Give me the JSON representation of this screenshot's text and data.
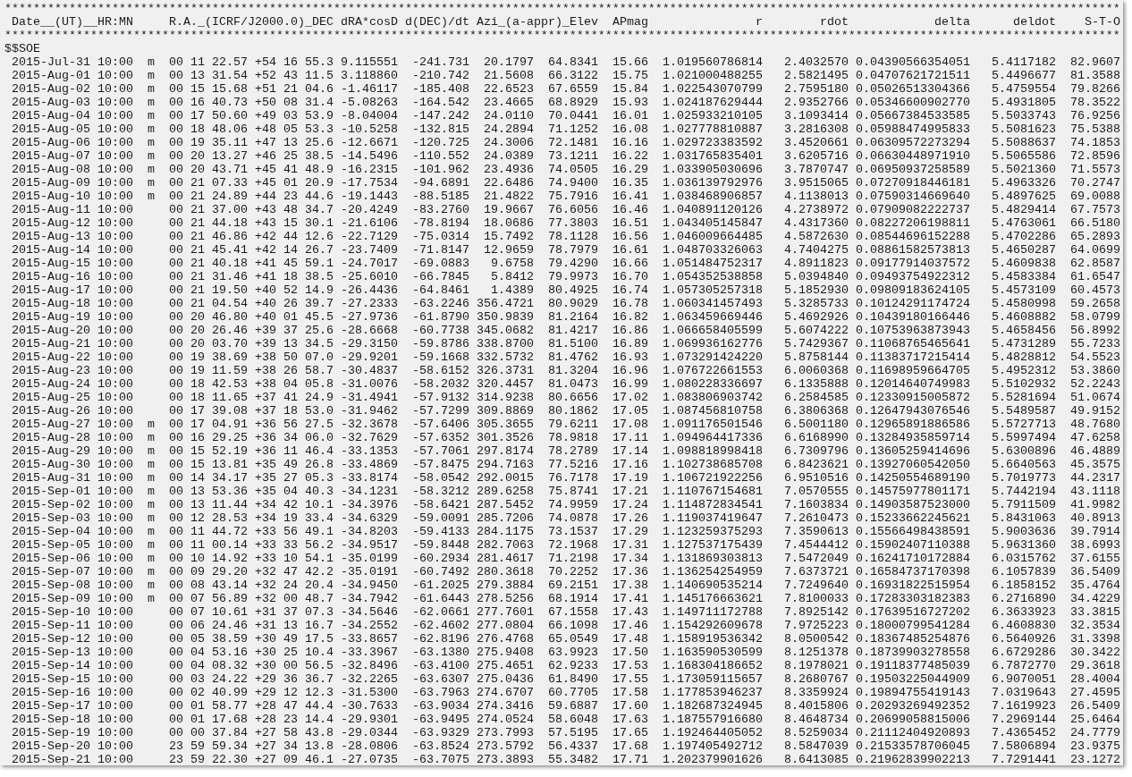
{
  "separator_top": "************************************************************************************************************************************************************",
  "header": [
    "Date__(UT)__HR:MN",
    "R.A._(ICRF/J2000.0)_DEC",
    "dRA*cosD",
    "d(DEC)/dt",
    "Azi_(a-appr)_Elev",
    "APmag",
    "r",
    "rdot",
    "delta",
    "deldot",
    "S-T-O"
  ],
  "separator_bottom": "************************************************************************************************************************************************************",
  "start_marker": "$$SOE",
  "rows": [
    {
      "date_time": "2015-Jul-31 10:00",
      "marker": "m",
      "ra": "00 11 22.57",
      "dec": "+54 16 55.3",
      "dra_cosd": "9.115551",
      "ddec_dt": "-241.731",
      "azi": "20.1797",
      "elev": "64.8341",
      "apmag": "15.66",
      "r": "1.019560786814",
      "rdot": "2.4032570",
      "delta": "0.04390566354051",
      "deldot": "5.4117182",
      "sto": "82.9607"
    },
    {
      "date_time": "2015-Aug-01 10:00",
      "marker": "m",
      "ra": "00 13 31.54",
      "dec": "+52 43 11.5",
      "dra_cosd": "3.118860",
      "ddec_dt": "-210.742",
      "azi": "21.5608",
      "elev": "66.3122",
      "apmag": "15.75",
      "r": "1.021000488255",
      "rdot": "2.5821495",
      "delta": "0.04707621721511",
      "deldot": "5.4496677",
      "sto": "81.3588"
    },
    {
      "date_time": "2015-Aug-02 10:00",
      "marker": "m",
      "ra": "00 15 15.68",
      "dec": "+51 21 04.6",
      "dra_cosd": "-1.46117",
      "ddec_dt": "-185.408",
      "azi": "22.6523",
      "elev": "67.6559",
      "apmag": "15.84",
      "r": "1.022543070799",
      "rdot": "2.7595180",
      "delta": "0.05026513304366",
      "deldot": "5.4759554",
      "sto": "79.8266"
    },
    {
      "date_time": "2015-Aug-03 10:00",
      "marker": "m",
      "ra": "00 16 40.73",
      "dec": "+50 08 31.4",
      "dra_cosd": "-5.08263",
      "ddec_dt": "-164.542",
      "azi": "23.4665",
      "elev": "68.8929",
      "apmag": "15.93",
      "r": "1.024187629444",
      "rdot": "2.9352766",
      "delta": "0.05346600902770",
      "deldot": "5.4931805",
      "sto": "78.3522"
    },
    {
      "date_time": "2015-Aug-04 10:00",
      "marker": "m",
      "ra": "00 17 50.60",
      "dec": "+49 03 53.9",
      "dra_cosd": "-8.04004",
      "ddec_dt": "-147.242",
      "azi": "24.0110",
      "elev": "70.0441",
      "apmag": "16.01",
      "r": "1.025933210105",
      "rdot": "3.1093414",
      "delta": "0.05667384533585",
      "deldot": "5.5033743",
      "sto": "76.9256"
    },
    {
      "date_time": "2015-Aug-05 10:00",
      "marker": "m",
      "ra": "00 18 48.06",
      "dec": "+48 05 53.3",
      "dra_cosd": "-10.5258",
      "ddec_dt": "-132.815",
      "azi": "24.2894",
      "elev": "71.1252",
      "apmag": "16.08",
      "r": "1.027778810887",
      "rdot": "3.2816308",
      "delta": "0.05988474995833",
      "deldot": "5.5081623",
      "sto": "75.5388"
    },
    {
      "date_time": "2015-Aug-06 10:00",
      "marker": "m",
      "ra": "00 19 35.11",
      "dec": "+47 13 25.6",
      "dra_cosd": "-12.6671",
      "ddec_dt": "-120.725",
      "azi": "24.3006",
      "elev": "72.1481",
      "apmag": "16.16",
      "r": "1.029723383592",
      "rdot": "3.4520661",
      "delta": "0.06309572273294",
      "deldot": "5.5088637",
      "sto": "74.1853"
    },
    {
      "date_time": "2015-Aug-07 10:00",
      "marker": "m",
      "ra": "00 20 13.27",
      "dec": "+46 25 38.5",
      "dra_cosd": "-14.5496",
      "ddec_dt": "-110.552",
      "azi": "24.0389",
      "elev": "73.1211",
      "apmag": "16.22",
      "r": "1.031765835401",
      "rdot": "3.6205716",
      "delta": "0.06630448971910",
      "deldot": "5.5065586",
      "sto": "72.8596"
    },
    {
      "date_time": "2015-Aug-08 10:00",
      "marker": "m",
      "ra": "00 20 43.71",
      "dec": "+45 41 48.9",
      "dra_cosd": "-16.2315",
      "ddec_dt": "-101.962",
      "azi": "23.4936",
      "elev": "74.0505",
      "apmag": "16.29",
      "r": "1.033905030696",
      "rdot": "3.7870747",
      "delta": "0.06950937258589",
      "deldot": "5.5021360",
      "sto": "71.5573"
    },
    {
      "date_time": "2015-Aug-09 10:00",
      "marker": "m",
      "ra": "00 21 07.33",
      "dec": "+45 01 20.9",
      "dra_cosd": "-17.7534",
      "ddec_dt": "-94.6891",
      "azi": "22.6486",
      "elev": "74.9400",
      "apmag": "16.35",
      "r": "1.036139792976",
      "rdot": "3.9515065",
      "delta": "0.07270918446181",
      "deldot": "5.4963326",
      "sto": "70.2747"
    },
    {
      "date_time": "2015-Aug-10 10:00",
      "marker": "m",
      "ra": "00 21 24.89",
      "dec": "+44 23 44.6",
      "dra_cosd": "-19.1443",
      "ddec_dt": "-88.5185",
      "azi": "21.4822",
      "elev": "75.7916",
      "apmag": "16.41",
      "r": "1.038468906857",
      "rdot": "4.1138013",
      "delta": "0.07590314669640",
      "deldot": "5.4897625",
      "sto": "69.0088"
    },
    {
      "date_time": "2015-Aug-11 10:00",
      "ra": "00 21 37.00",
      "dec": "+43 48 34.7",
      "dra_cosd": "-20.4249",
      "ddec_dt": "-83.2760",
      "azi": "19.9667",
      "elev": "76.6056",
      "apmag": "16.46",
      "r": "1.040891120126",
      "rdot": "4.2738972",
      "delta": "0.07909082222737",
      "deldot": "5.4829414",
      "sto": "67.7573"
    },
    {
      "date_time": "2015-Aug-12 10:00",
      "ra": "00 21 44.18",
      "dec": "+43 15 30.1",
      "dra_cosd": "-21.6106",
      "ddec_dt": "-78.8194",
      "azi": "18.0686",
      "elev": "77.3803",
      "apmag": "16.51",
      "r": "1.043405145847",
      "rdot": "4.4317360",
      "delta": "0.08227206198811",
      "deldot": "5.4763061",
      "sto": "66.5180"
    },
    {
      "date_time": "2015-Aug-13 10:00",
      "ra": "00 21 46.86",
      "dec": "+42 44 12.6",
      "dra_cosd": "-22.7129",
      "ddec_dt": "-75.0314",
      "azi": "15.7492",
      "elev": "78.1128",
      "apmag": "16.56",
      "r": "1.046009664485",
      "rdot": "4.5872630",
      "delta": "0.08544696152288",
      "deldot": "5.4702286",
      "sto": "65.2893"
    },
    {
      "date_time": "2015-Aug-14 10:00",
      "ra": "00 21 45.41",
      "dec": "+42 14 26.7",
      "dra_cosd": "-23.7409",
      "ddec_dt": "-71.8147",
      "azi": "12.9659",
      "elev": "78.7979",
      "apmag": "16.61",
      "r": "1.048703326063",
      "rdot": "4.7404275",
      "delta": "0.08861582573813",
      "deldot": "5.4650287",
      "sto": "64.0699"
    },
    {
      "date_time": "2015-Aug-15 10:00",
      "ra": "00 21 40.18",
      "dec": "+41 45 59.1",
      "dra_cosd": "-24.7017",
      "ddec_dt": "-69.0883",
      "azi": "9.6758",
      "elev": "79.4290",
      "apmag": "16.66",
      "r": "1.051484752317",
      "rdot": "4.8911823",
      "delta": "0.09177914037572",
      "deldot": "5.4609838",
      "sto": "62.8587"
    },
    {
      "date_time": "2015-Aug-16 10:00",
      "ra": "00 21 31.46",
      "dec": "+41 18 38.5",
      "dra_cosd": "-25.6010",
      "ddec_dt": "-66.7845",
      "azi": "5.8412",
      "elev": "79.9973",
      "apmag": "16.70",
      "r": "1.054352538858",
      "rdot": "5.0394840",
      "delta": "0.09493754922312",
      "deldot": "5.4583384",
      "sto": "61.6547"
    },
    {
      "date_time": "2015-Aug-17 10:00",
      "ra": "00 21 19.50",
      "dec": "+40 52 14.9",
      "dra_cosd": "-26.4436",
      "ddec_dt": "-64.8461",
      "azi": "1.4389",
      "elev": "80.4925",
      "apmag": "16.74",
      "r": "1.057305257318",
      "rdot": "5.1852930",
      "delta": "0.09809183624105",
      "deldot": "5.4573109",
      "sto": "60.4573"
    },
    {
      "date_time": "2015-Aug-18 10:00",
      "ra": "00 21 04.54",
      "dec": "+40 26 39.7",
      "dra_cosd": "-27.2333",
      "ddec_dt": "-63.2246",
      "azi": "356.4721",
      "elev": "80.9029",
      "apmag": "16.78",
      "r": "1.060341457493",
      "rdot": "5.3285733",
      "delta": "0.10124291174724",
      "deldot": "5.4580998",
      "sto": "59.2658"
    },
    {
      "date_time": "2015-Aug-19 10:00",
      "ra": "00 20 46.80",
      "dec": "+40 01 45.5",
      "dra_cosd": "-27.9736",
      "ddec_dt": "-61.8790",
      "azi": "350.9839",
      "elev": "81.2164",
      "apmag": "16.82",
      "r": "1.063459669446",
      "rdot": "5.4692926",
      "delta": "0.10439180166446",
      "deldot": "5.4608882",
      "sto": "58.0799"
    },
    {
      "date_time": "2015-Aug-20 10:00",
      "ra": "00 20 26.46",
      "dec": "+39 37 25.6",
      "dra_cosd": "-28.6668",
      "ddec_dt": "-60.7738",
      "azi": "345.0682",
      "elev": "81.4217",
      "apmag": "16.86",
      "r": "1.066658405599",
      "rdot": "5.6074222",
      "delta": "0.10753963873943",
      "deldot": "5.4658456",
      "sto": "56.8992"
    },
    {
      "date_time": "2015-Aug-21 10:00",
      "ra": "00 20 03.70",
      "dec": "+39 13 34.5",
      "dra_cosd": "-29.3150",
      "ddec_dt": "-59.8786",
      "azi": "338.8700",
      "elev": "81.5100",
      "apmag": "16.89",
      "r": "1.069936162776",
      "rdot": "5.7429367",
      "delta": "0.11068765465641",
      "deldot": "5.4731289",
      "sto": "55.7233"
    },
    {
      "date_time": "2015-Aug-22 10:00",
      "ra": "00 19 38.69",
      "dec": "+38 50 07.0",
      "dra_cosd": "-29.9201",
      "ddec_dt": "-59.1668",
      "azi": "332.5732",
      "elev": "81.4762",
      "apmag": "16.93",
      "r": "1.073291424220",
      "rdot": "5.8758144",
      "delta": "0.11383717215414",
      "deldot": "5.4828812",
      "sto": "54.5523"
    },
    {
      "date_time": "2015-Aug-23 10:00",
      "ra": "00 19 11.59",
      "dec": "+38 26 58.7",
      "dra_cosd": "-30.4837",
      "ddec_dt": "-58.6152",
      "azi": "326.3731",
      "elev": "81.3204",
      "apmag": "16.96",
      "r": "1.076722661553",
      "rdot": "6.0060368",
      "delta": "0.11698959664705",
      "deldot": "5.4952312",
      "sto": "53.3860"
    },
    {
      "date_time": "2015-Aug-24 10:00",
      "ra": "00 18 42.53",
      "dec": "+38 04 05.8",
      "dra_cosd": "-31.0076",
      "ddec_dt": "-58.2032",
      "azi": "320.4457",
      "elev": "81.0473",
      "apmag": "16.99",
      "r": "1.080228336697",
      "rdot": "6.1335888",
      "delta": "0.12014640749983",
      "deldot": "5.5102932",
      "sto": "52.2243"
    },
    {
      "date_time": "2015-Aug-25 10:00",
      "ra": "00 18 11.65",
      "dec": "+37 41 24.9",
      "dra_cosd": "-31.4941",
      "ddec_dt": "-57.9132",
      "azi": "314.9238",
      "elev": "80.6656",
      "apmag": "17.02",
      "r": "1.083806903742",
      "rdot": "6.2584585",
      "delta": "0.12330915005872",
      "deldot": "5.5281694",
      "sto": "51.0674"
    },
    {
      "date_time": "2015-Aug-26 10:00",
      "ra": "00 17 39.08",
      "dec": "+37 18 53.0",
      "dra_cosd": "-31.9462",
      "ddec_dt": "-57.7299",
      "azi": "309.8869",
      "elev": "80.1862",
      "apmag": "17.05",
      "r": "1.087456810758",
      "rdot": "6.3806368",
      "delta": "0.12647943076546",
      "deldot": "5.5489587",
      "sto": "49.9152"
    },
    {
      "date_time": "2015-Aug-27 10:00",
      "marker": "m",
      "ra": "00 17 04.91",
      "dec": "+36 56 27.5",
      "dra_cosd": "-32.3678",
      "ddec_dt": "-57.6406",
      "azi": "305.3655",
      "elev": "79.6211",
      "apmag": "17.08",
      "r": "1.091176501546",
      "rdot": "6.5001180",
      "delta": "0.12965891886586",
      "deldot": "5.5727713",
      "sto": "48.7680"
    },
    {
      "date_time": "2015-Aug-28 10:00",
      "marker": "m",
      "ra": "00 16 29.25",
      "dec": "+36 34 06.0",
      "dra_cosd": "-32.7629",
      "ddec_dt": "-57.6352",
      "azi": "301.3526",
      "elev": "78.9818",
      "apmag": "17.11",
      "r": "1.094964417336",
      "rdot": "6.6168990",
      "delta": "0.13284935859714",
      "deldot": "5.5997494",
      "sto": "47.6258"
    },
    {
      "date_time": "2015-Aug-29 10:00",
      "marker": "m",
      "ra": "00 15 52.19",
      "dec": "+36 11 46.4",
      "dra_cosd": "-33.1353",
      "ddec_dt": "-57.7061",
      "azi": "297.8174",
      "elev": "78.2789",
      "apmag": "17.14",
      "r": "1.098818998418",
      "rdot": "6.7309796",
      "delta": "0.13605259414696",
      "deldot": "5.6300896",
      "sto": "46.4889"
    },
    {
      "date_time": "2015-Aug-30 10:00",
      "marker": "m",
      "ra": "00 15 13.81",
      "dec": "+35 49 26.8",
      "dra_cosd": "-33.4869",
      "ddec_dt": "-57.8475",
      "azi": "294.7163",
      "elev": "77.5216",
      "apmag": "17.16",
      "r": "1.102738685708",
      "rdot": "6.8423621",
      "delta": "0.13927060542050",
      "deldot": "5.6640563",
      "sto": "45.3575"
    },
    {
      "date_time": "2015-Aug-31 10:00",
      "marker": "m",
      "ra": "00 14 34.17",
      "dec": "+35 27 05.3",
      "dra_cosd": "-33.8174",
      "ddec_dt": "-58.0542",
      "azi": "292.0015",
      "elev": "76.7178",
      "apmag": "17.19",
      "r": "1.106721922256",
      "rdot": "6.9510516",
      "delta": "0.14250554689190",
      "deldot": "5.7019773",
      "sto": "44.2317"
    },
    {
      "date_time": "2015-Sep-01 10:00",
      "marker": "m",
      "ra": "00 13 53.36",
      "dec": "+35 04 40.3",
      "dra_cosd": "-34.1231",
      "ddec_dt": "-58.3212",
      "azi": "289.6258",
      "elev": "75.8741",
      "apmag": "17.21",
      "r": "1.110767154681",
      "rdot": "7.0570555",
      "delta": "0.14575977801171",
      "deldot": "5.7442194",
      "sto": "43.1118"
    },
    {
      "date_time": "2015-Sep-02 10:00",
      "marker": "m",
      "ra": "00 13 11.44",
      "dec": "+34 42 10.1",
      "dra_cosd": "-34.3976",
      "ddec_dt": "-58.6421",
      "azi": "287.5452",
      "elev": "74.9959",
      "apmag": "17.24",
      "r": "1.114872834541",
      "rdot": "7.1603834",
      "delta": "0.14903587523000",
      "deldot": "5.7911509",
      "sto": "41.9982"
    },
    {
      "date_time": "2015-Sep-03 10:00",
      "marker": "m",
      "ra": "00 12 28.53",
      "dec": "+34 19 33.4",
      "dra_cosd": "-34.6329",
      "ddec_dt": "-59.0091",
      "azi": "285.7206",
      "elev": "74.0878",
      "apmag": "17.26",
      "r": "1.119037419647",
      "rdot": "7.2610473",
      "delta": "0.15233662245621",
      "deldot": "5.8431063",
      "sto": "40.8913"
    },
    {
      "date_time": "2015-Sep-04 10:00",
      "marker": "m",
      "ra": "00 11 44.72",
      "dec": "+33 56 49.1",
      "dra_cosd": "-34.8203",
      "ddec_dt": "-59.4133",
      "azi": "284.1175",
      "elev": "73.1537",
      "apmag": "17.29",
      "r": "1.123259375293",
      "rdot": "7.3590613",
      "delta": "0.15566498438591",
      "deldot": "5.9003636",
      "sto": "39.7914"
    },
    {
      "date_time": "2015-Sep-05 10:00",
      "marker": "m",
      "ra": "00 11 00.14",
      "dec": "+33 33 56.2",
      "dra_cosd": "-34.9517",
      "ddec_dt": "-59.8448",
      "azi": "282.7063",
      "elev": "72.1968",
      "apmag": "17.31",
      "r": "1.127537175439",
      "rdot": "7.4544412",
      "delta": "0.15902407110388",
      "deldot": "5.9631360",
      "sto": "38.6993"
    },
    {
      "date_time": "2015-Sep-06 10:00",
      "marker": "m",
      "ra": "00 10 14.92",
      "dec": "+33 10 54.1",
      "dra_cosd": "-35.0199",
      "ddec_dt": "-60.2934",
      "azi": "281.4617",
      "elev": "71.2198",
      "apmag": "17.34",
      "r": "1.131869303813",
      "rdot": "7.5472049",
      "delta": "0.16241710172884",
      "deldot": "6.0315762",
      "sto": "37.6155"
    },
    {
      "date_time": "2015-Sep-07 10:00",
      "marker": "m",
      "ra": "00 09 29.20",
      "dec": "+32 47 42.2",
      "dra_cosd": "-35.0191",
      "ddec_dt": "-60.7492",
      "azi": "280.3618",
      "elev": "70.2252",
      "apmag": "17.36",
      "r": "1.136254254959",
      "rdot": "7.6373721",
      "delta": "0.16584737170398",
      "deldot": "6.1057839",
      "sto": "36.5409"
    },
    {
      "date_time": "2015-Sep-08 10:00",
      "marker": "m",
      "ra": "00 08 43.14",
      "dec": "+32 24 20.4",
      "dra_cosd": "-34.9450",
      "ddec_dt": "-61.2025",
      "azi": "279.3884",
      "elev": "69.2151",
      "apmag": "17.38",
      "r": "1.140690535214",
      "rdot": "7.7249640",
      "delta": "0.16931822515954",
      "deldot": "6.1858152",
      "sto": "35.4764"
    },
    {
      "date_time": "2015-Sep-09 10:00",
      "marker": "m",
      "ra": "00 07 56.89",
      "dec": "+32 00 48.7",
      "dra_cosd": "-34.7942",
      "ddec_dt": "-61.6443",
      "azi": "278.5256",
      "elev": "68.1914",
      "apmag": "17.41",
      "r": "1.145176663621",
      "rdot": "7.8100033",
      "delta": "0.17283303182383",
      "deldot": "6.2716890",
      "sto": "34.4229"
    },
    {
      "date_time": "2015-Sep-10 10:00",
      "ra": "00 07 10.61",
      "dec": "+31 37 07.3",
      "dra_cosd": "-34.5646",
      "ddec_dt": "-62.0661",
      "azi": "277.7601",
      "elev": "67.1558",
      "apmag": "17.43",
      "r": "1.149711172788",
      "rdot": "7.8925142",
      "delta": "0.17639516727202",
      "deldot": "6.3633923",
      "sto": "33.3815"
    },
    {
      "date_time": "2015-Sep-11 10:00",
      "ra": "00 06 24.46",
      "dec": "+31 13 16.7",
      "dra_cosd": "-34.2552",
      "ddec_dt": "-62.4602",
      "azi": "277.0804",
      "elev": "66.1098",
      "apmag": "17.46",
      "r": "1.154292609678",
      "rdot": "7.9725223",
      "delta": "0.18000799541284",
      "deldot": "6.4608830",
      "sto": "32.3534"
    },
    {
      "date_time": "2015-Sep-12 10:00",
      "ra": "00 05 38.59",
      "dec": "+30 49 17.5",
      "dra_cosd": "-33.8657",
      "ddec_dt": "-62.8196",
      "azi": "276.4768",
      "elev": "65.0549",
      "apmag": "17.48",
      "r": "1.158919536342",
      "rdot": "8.0500542",
      "delta": "0.18367485254876",
      "deldot": "6.5640926",
      "sto": "31.3398"
    },
    {
      "date_time": "2015-Sep-13 10:00",
      "ra": "00 04 53.16",
      "dec": "+30 25 10.4",
      "dra_cosd": "-33.3967",
      "ddec_dt": "-63.1380",
      "azi": "275.9408",
      "elev": "63.9923",
      "apmag": "17.50",
      "r": "1.163590530599",
      "rdot": "8.1251378",
      "delta": "0.18739903278558",
      "deldot": "6.6729286",
      "sto": "30.3422"
    },
    {
      "date_time": "2015-Sep-14 10:00",
      "ra": "00 04 08.32",
      "dec": "+30 00 56.5",
      "dra_cosd": "-32.8496",
      "ddec_dt": "-63.4100",
      "azi": "275.4651",
      "elev": "62.9233",
      "apmag": "17.53",
      "r": "1.168304186652",
      "rdot": "8.1978021",
      "delta": "0.19118377485039",
      "deldot": "6.7872770",
      "sto": "29.3618"
    },
    {
      "date_time": "2015-Sep-15 10:00",
      "ra": "00 03 24.22",
      "dec": "+29 36 36.7",
      "dra_cosd": "-32.2265",
      "ddec_dt": "-63.6307",
      "azi": "275.0436",
      "elev": "61.8490",
      "apmag": "17.55",
      "r": "1.173059115657",
      "rdot": "8.2680767",
      "delta": "0.19503225044909",
      "deldot": "6.9070051",
      "sto": "28.4004"
    },
    {
      "date_time": "2015-Sep-16 10:00",
      "ra": "00 02 40.99",
      "dec": "+29 12 12.3",
      "dra_cosd": "-31.5300",
      "ddec_dt": "-63.7963",
      "azi": "274.6707",
      "elev": "60.7705",
      "apmag": "17.58",
      "r": "1.177853946237",
      "rdot": "8.3359924",
      "delta": "0.19894755419143",
      "deldot": "7.0319643",
      "sto": "27.4595"
    },
    {
      "date_time": "2015-Sep-17 10:00",
      "ra": "00 01 58.77",
      "dec": "+28 47 44.4",
      "dra_cosd": "-30.7633",
      "ddec_dt": "-63.9034",
      "azi": "274.3416",
      "elev": "59.6887",
      "apmag": "17.60",
      "r": "1.182687324945",
      "rdot": "8.4015806",
      "delta": "0.20293269492352",
      "deldot": "7.1619923",
      "sto": "26.5409"
    },
    {
      "date_time": "2015-Sep-18 10:00",
      "ra": "00 01 17.68",
      "dec": "+28 23 14.4",
      "dra_cosd": "-29.9301",
      "ddec_dt": "-63.9495",
      "azi": "274.0524",
      "elev": "58.6048",
      "apmag": "17.63",
      "r": "1.187557916680",
      "rdot": "8.4648734",
      "delta": "0.20699058815006",
      "deldot": "7.2969144",
      "sto": "25.6464"
    },
    {
      "date_time": "2015-Sep-19 10:00",
      "ra": "00 00 37.84",
      "dec": "+27 58 43.8",
      "dra_cosd": "-29.0344",
      "ddec_dt": "-63.9329",
      "azi": "273.7993",
      "elev": "57.5195",
      "apmag": "17.65",
      "r": "1.192464405052",
      "rdot": "8.5259034",
      "delta": "0.21112404920893",
      "deldot": "7.4365452",
      "sto": "24.7779"
    },
    {
      "date_time": "2015-Sep-20 10:00",
      "ra": "23 59 59.34",
      "dec": "+27 34 13.8",
      "dra_cosd": "-28.0806",
      "ddec_dt": "-63.8524",
      "azi": "273.5792",
      "elev": "56.4337",
      "apmag": "17.68",
      "r": "1.197405492712",
      "rdot": "8.5847039",
      "delta": "0.21533578706045",
      "deldot": "7.5806894",
      "sto": "23.9375"
    },
    {
      "date_time": "2015-Sep-21 10:00",
      "ra": "23 59 22.30",
      "dec": "+27 09 46.1",
      "dra_cosd": "-27.0735",
      "ddec_dt": "-63.7075",
      "azi": "273.3893",
      "elev": "55.3482",
      "apmag": "17.71",
      "r": "1.202379901626",
      "rdot": "8.6413085",
      "delta": "0.21962839902213",
      "deldot": "7.7291441",
      "sto": "23.1272"
    }
  ]
}
